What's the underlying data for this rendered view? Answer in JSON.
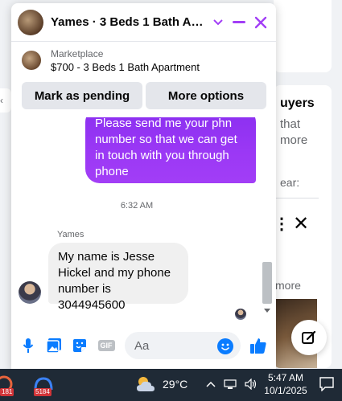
{
  "background": {
    "heading": "uyers",
    "line1": "that",
    "line2": "more",
    "line3": "ear:",
    "dots": "⋮",
    "close": "✕",
    "see_more": "more",
    "left_chevron": "‹"
  },
  "chat": {
    "title": "Yames · 3 Beds 1 Bath Apa...",
    "listing": {
      "source": "Marketplace",
      "name": "$700 - 3 Beds 1 Bath Apartment"
    },
    "actions": {
      "mark_pending": "Mark as pending",
      "more_options": "More options"
    },
    "messages": {
      "outgoing_text": "Please send me your phn number so that we can get in touch with you through phone",
      "timestamp": "6:32 AM",
      "sender_name": "Yames",
      "incoming_text": "My name is Jesse Hickel and my phone number is 3044945600"
    },
    "composer": {
      "placeholder": "Aa",
      "gif_label": "GIF"
    }
  },
  "taskbar": {
    "app1_badge": "181",
    "app2_badge": "5184",
    "temperature": "29°C",
    "time": "5:47 AM",
    "date": "10/1/2025"
  },
  "colors": {
    "accent": "#a23ef6",
    "messenger_blue": "#0a7cff",
    "taskbar": "#1f2a36"
  }
}
